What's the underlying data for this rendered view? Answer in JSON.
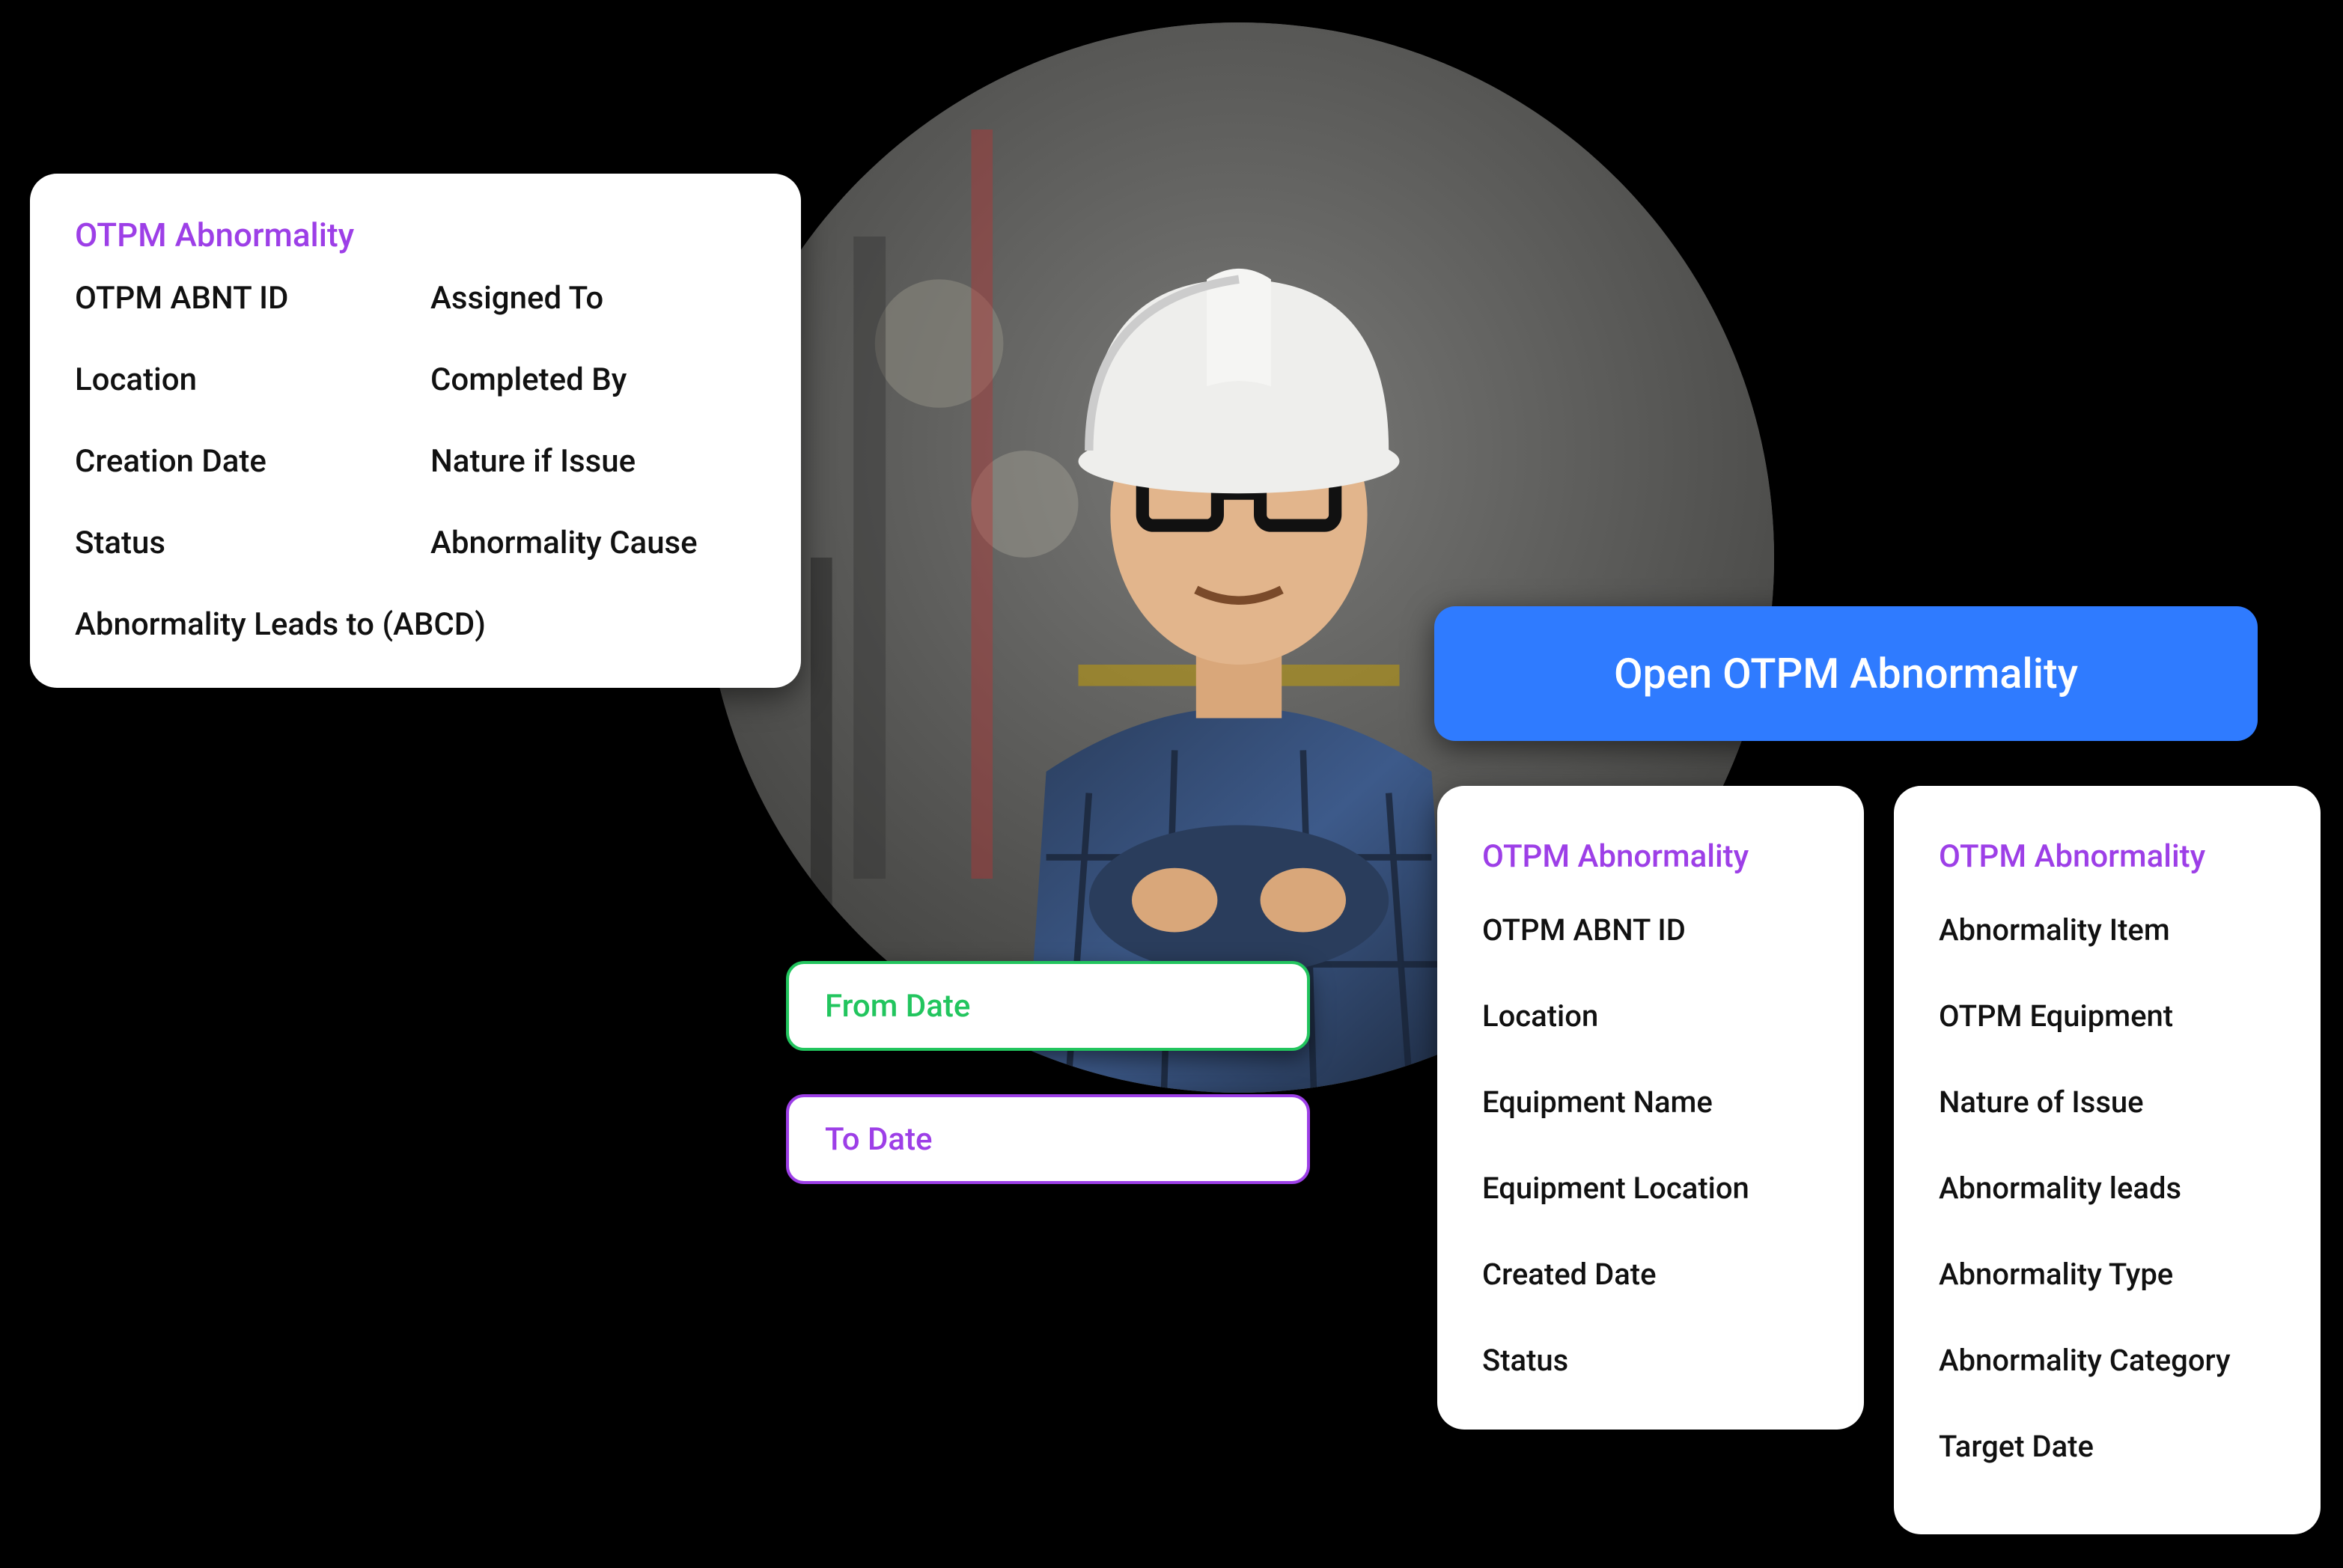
{
  "topCard": {
    "title": "OTPM Abnormality",
    "fields": [
      "OTPM ABNT ID",
      "Assigned To",
      "Location",
      "Completed By",
      "Creation Date",
      "Nature if Issue",
      "Status",
      "Abnormality Cause",
      "Abnormality Leads to (ABCD)"
    ]
  },
  "datePills": {
    "from": "From Date",
    "to": "To Date"
  },
  "banner": {
    "label": "Open OTPM Abnormality"
  },
  "subLeft": {
    "title": "OTPM Abnormality",
    "fields": [
      "OTPM ABNT ID",
      "Location",
      "Equipment Name",
      "Equipment Location",
      "Created Date",
      "Status"
    ]
  },
  "subRight": {
    "title": "OTPM Abnormality",
    "fields": [
      "Abnormality Item",
      "OTPM Equipment",
      "Nature of Issue",
      "Abnormality leads",
      "Abnormality Type",
      "Abnormality Category",
      "Target Date"
    ]
  }
}
